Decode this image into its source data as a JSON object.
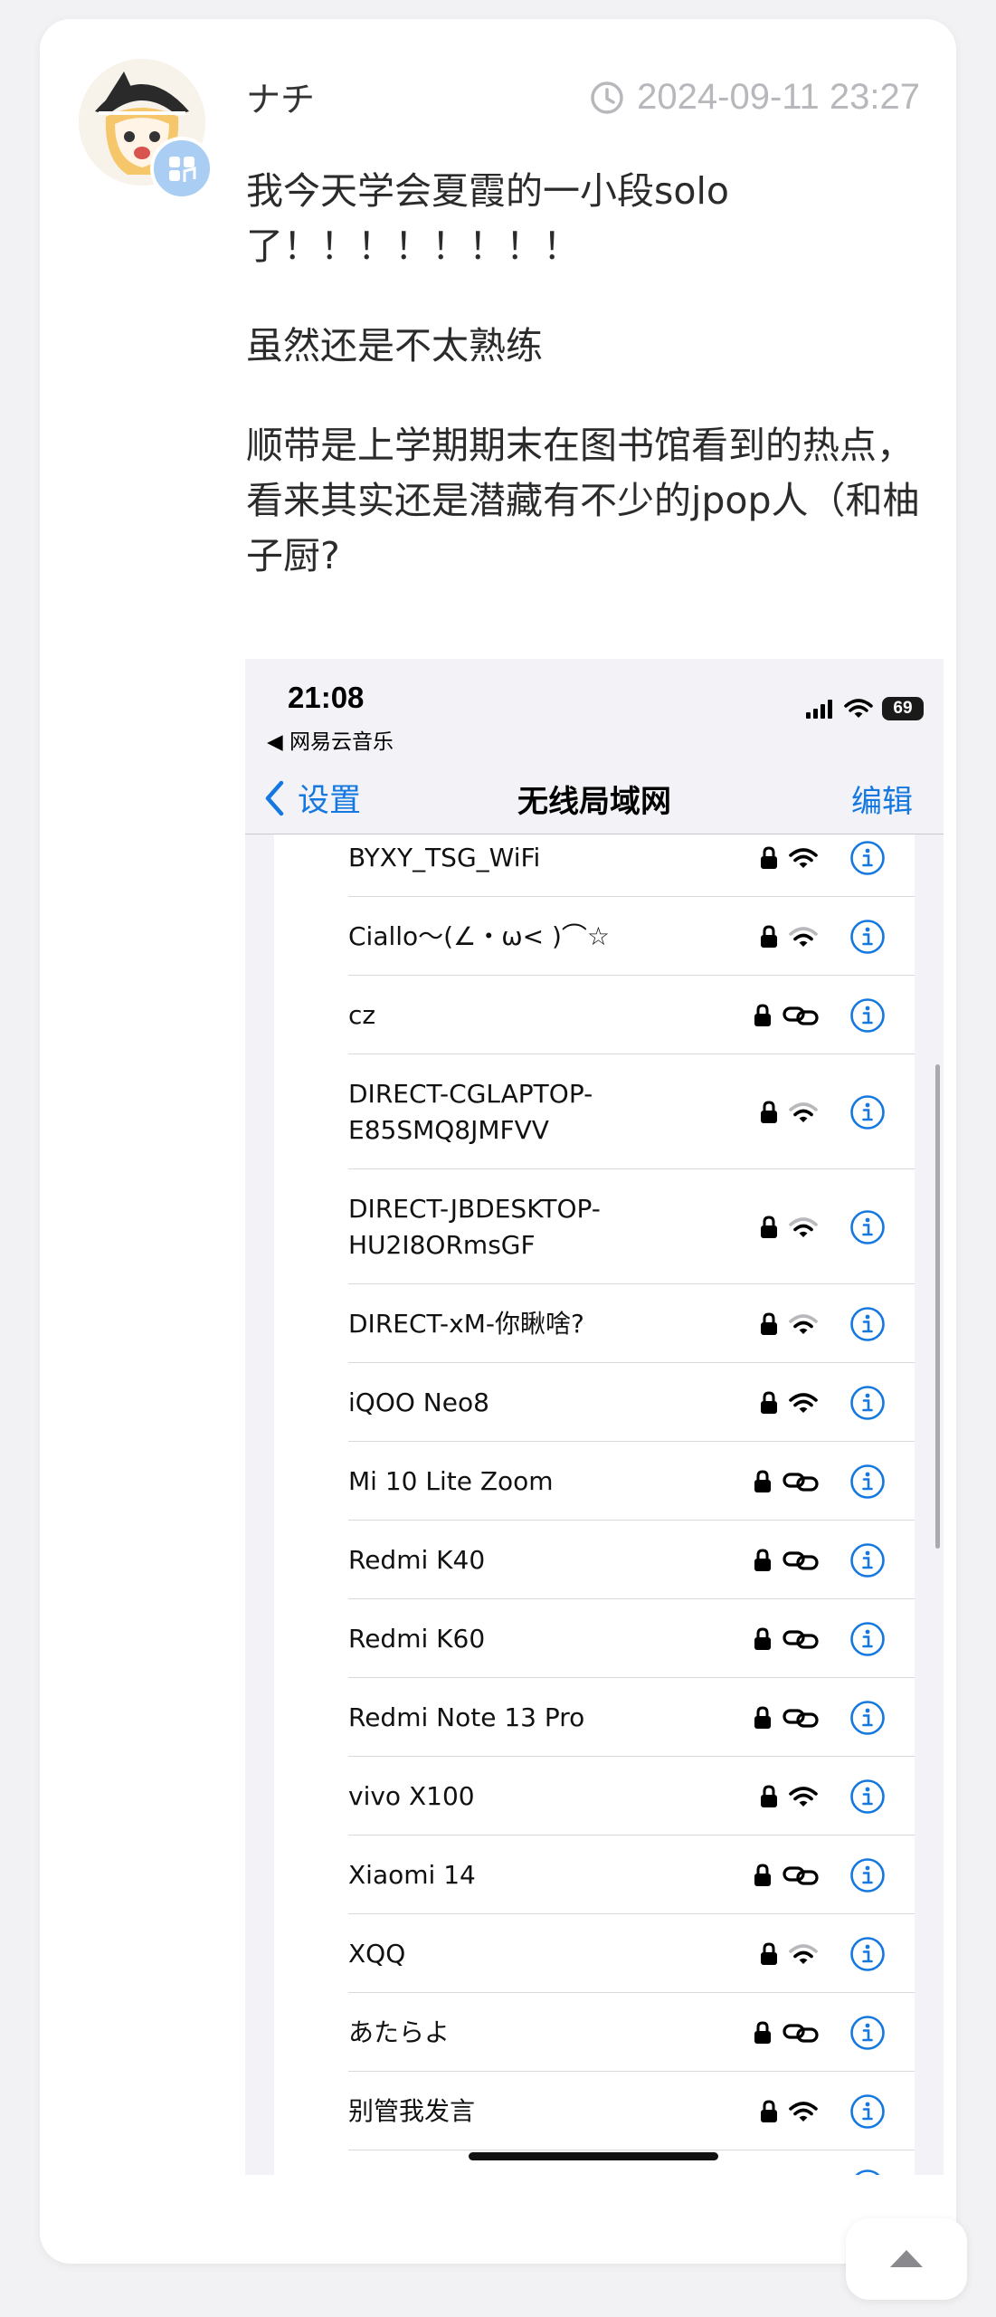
{
  "post": {
    "username": "ナチ",
    "timestamp": "2024-09-11 23:27",
    "paragraphs": [
      "我今天学会夏霞的一小段solo\n了！！！！！！！！",
      "虽然还是不太熟练",
      "顺带是上学期期末在图书馆看到的热点，看来其实还是潜藏有不少的jpop人（和柚子厨?"
    ]
  },
  "screenshot": {
    "status_time": "21:08",
    "back_app": "◀ 网易云音乐",
    "battery": "69",
    "nav_back_label": "设置",
    "nav_title": "无线局域网",
    "nav_edit": "编辑",
    "networks": [
      {
        "name": "BYXY_TSG_WiFi",
        "signal": "wifi-full"
      },
      {
        "name": "Ciallo～(∠・ω< )⌒☆",
        "signal": "wifi-weak"
      },
      {
        "name": "cz",
        "signal": "hotspot"
      },
      {
        "name": "DIRECT-CGLAPTOP-\nE85SMQ8JMFVV",
        "signal": "wifi-weak"
      },
      {
        "name": "DIRECT-JBDESKTOP-\nHU2I8ORmsGF",
        "signal": "wifi-weak"
      },
      {
        "name": "DIRECT-xM-你瞅啥?",
        "signal": "wifi-weak"
      },
      {
        "name": "iQOO Neo8",
        "signal": "wifi-full"
      },
      {
        "name": "Mi 10 Lite Zoom",
        "signal": "hotspot"
      },
      {
        "name": "Redmi K40",
        "signal": "hotspot"
      },
      {
        "name": "Redmi K60",
        "signal": "hotspot"
      },
      {
        "name": "Redmi Note 13 Pro",
        "signal": "hotspot"
      },
      {
        "name": "vivo X100",
        "signal": "wifi-full"
      },
      {
        "name": "Xiaomi 14",
        "signal": "hotspot"
      },
      {
        "name": "XQQ",
        "signal": "wifi-weak"
      },
      {
        "name": "あたらよ",
        "signal": "hotspot"
      },
      {
        "name": "别管我发言",
        "signal": "wifi-full"
      }
    ]
  },
  "colors": {
    "ios_blue": "#1478e0",
    "timestamp_gray": "#b8b8bc",
    "badge_blue": "#a9cdf3"
  },
  "icons": {
    "clock": "clock-icon",
    "lock": "lock-icon",
    "wifi": "wifi-icon",
    "hotspot": "link-icon",
    "info": "info-icon",
    "back": "chevron-left-icon",
    "scroll_top": "caret-up-icon"
  }
}
